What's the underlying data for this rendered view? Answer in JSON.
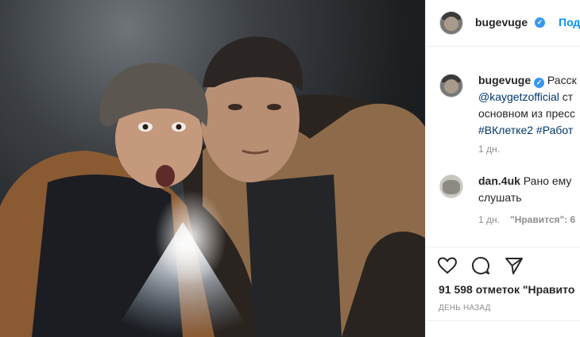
{
  "post": {
    "username": "bugevuge",
    "follow_label": "Под",
    "verified_icon": "verified-badge-icon",
    "photo_alt": "photo"
  },
  "caption": {
    "username": "bugevuge",
    "line1_text": "Расск",
    "line2_mention": "@kaygetzofficial",
    "line2_text": " ст",
    "line3_text": "основном из пресс",
    "line4_tags": "#ВКлетке2 #Работ",
    "time": "1 дн."
  },
  "comment": {
    "username": "dan.4uk",
    "line1_text": "Рано ему",
    "line2_text": "слушать",
    "time": "1 дн.",
    "likes_label": "\"Нравится\": 6"
  },
  "actions": {
    "likes_text": "91 598 отметок \"Нравито",
    "time_ago": "ДЕНЬ НАЗАД"
  },
  "colors": {
    "accent": "#0095f6",
    "link": "#00376b",
    "muted": "#8e8e8e"
  }
}
